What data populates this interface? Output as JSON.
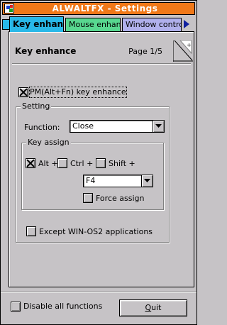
{
  "window": {
    "title": "ALWALTFX - Settings"
  },
  "tabs": [
    {
      "label": "Key enhance",
      "active": true
    },
    {
      "label": "Mouse enhance",
      "active": false
    },
    {
      "label": "Window control",
      "active": false
    }
  ],
  "page": {
    "title": "Key enhance",
    "page_number": "Page 1/5"
  },
  "pm_key_enhance": {
    "label": "PM(Alt+Fn) key enhance",
    "checked": true
  },
  "setting": {
    "group_label": "Setting",
    "function_label": "Function:",
    "function_value": "Close",
    "key_assign": {
      "group_label": "Key assign",
      "alt": {
        "label": "Alt +",
        "checked": true
      },
      "ctrl": {
        "label": "Ctrl +",
        "checked": false
      },
      "shift": {
        "label": "Shift +",
        "checked": false
      },
      "key_value": "F4",
      "force_assign": {
        "label": "Force assign",
        "checked": false
      }
    },
    "except_win_os2": {
      "label": "Except WIN-OS2 applications",
      "checked": false
    }
  },
  "footer": {
    "disable_all": {
      "label": "Disable all functions",
      "checked": false
    },
    "quit_mnemonic": "Q",
    "quit_rest": "uit"
  },
  "colors": {
    "titlebar": "#f07818",
    "tab_key_enhance": "#28b8e8",
    "tab_mouse_enhance": "#58d890",
    "tab_window_control": "#b0b0ec",
    "dialog_face": "#c6c3c6"
  },
  "icons": {
    "system_menu": "system-menu-icon",
    "tab_scroll": "triangle-right-icon",
    "dropdown": "triangle-down-icon",
    "page_turn": "page-corner-icon"
  }
}
